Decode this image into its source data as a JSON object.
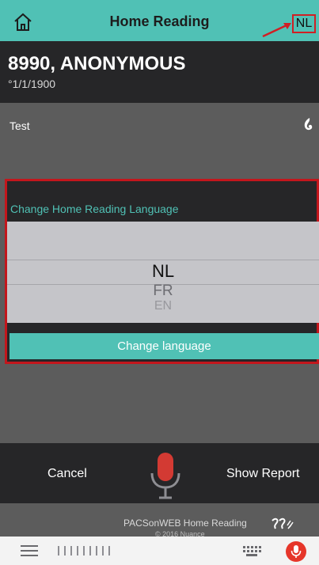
{
  "header": {
    "title": "Home Reading",
    "language_badge": "NL",
    "home_icon": "home-icon",
    "accent_color": "#50c1b5",
    "highlight_color": "#d01f24"
  },
  "patient": {
    "name": "8990, ANONYMOUS",
    "dob": "°1/1/1900"
  },
  "report": {
    "item_label": "Test",
    "icon": "dragon-flame-icon"
  },
  "language_panel": {
    "heading": "Change Home Reading Language",
    "options": [
      "NL",
      "FR",
      "EN"
    ],
    "selected": "NL",
    "button_label": "Change language"
  },
  "actions": {
    "cancel_label": "Cancel",
    "show_report_label": "Show Report",
    "mic_icon": "microphone-icon",
    "mic_color": "#d33a33"
  },
  "footer": {
    "app_name": "PACSonWEB Home Reading",
    "sub_text": "© 2016 Nuance",
    "logo": "dragon-logo-icon"
  },
  "keyboard_bar": {
    "menu_icon": "menu-icon",
    "waveform_icon": "waveform-icon",
    "keyboard_icon": "keyboard-icon",
    "mic_icon": "microphone-icon"
  }
}
